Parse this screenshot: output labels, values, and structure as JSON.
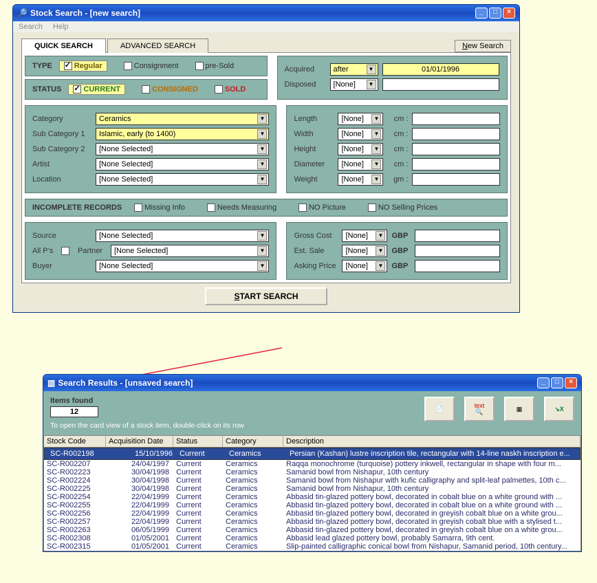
{
  "search_window": {
    "title": "Stock Search - [new search]",
    "menu": {
      "search": "Search",
      "help": "Help"
    },
    "tabs": {
      "quick": "QUICK SEARCH",
      "advanced": "ADVANCED SEARCH"
    },
    "new_search": "New Search",
    "type": {
      "label": "TYPE",
      "regular": "Regular",
      "consignment": "Consignment",
      "presold": "pre-Sold"
    },
    "status": {
      "label": "STATUS",
      "current": "CURRENT",
      "consigned": "CONSIGNED",
      "sold": "SOLD"
    },
    "acquired": {
      "label": "Acquired",
      "op": "after",
      "value": "01/01/1996"
    },
    "disposed": {
      "label": "Disposed",
      "op": "[None]",
      "value": ""
    },
    "category": {
      "label": "Category",
      "value": "Ceramics"
    },
    "sub1": {
      "label": "Sub Category 1",
      "value": "Islamic, early (to 1400)"
    },
    "sub2": {
      "label": "Sub Category 2",
      "value": "[None Selected]"
    },
    "artist": {
      "label": "Artist",
      "value": "[None Selected]"
    },
    "location": {
      "label": "Location",
      "value": "[None Selected]"
    },
    "dims": {
      "length": "Length",
      "width": "Width",
      "height": "Height",
      "diameter": "Diameter",
      "weight": "Weight",
      "none": "[None]",
      "cm": "cm :",
      "gm": "gm :"
    },
    "incomplete": {
      "label": "INCOMPLETE RECORDS",
      "missing": "Missing Info",
      "measure": "Needs Measuring",
      "nopic": "NO Picture",
      "nosell": "NO Selling Prices"
    },
    "source": {
      "label": "Source",
      "value": "[None Selected]"
    },
    "allps": "All P's",
    "partner": {
      "label": "Partner",
      "value": "[None Selected]"
    },
    "buyer": {
      "label": "Buyer",
      "value": "[None Selected]"
    },
    "gross": {
      "label": "Gross Cost",
      "op": "[None]",
      "cur": "GBP"
    },
    "est": {
      "label": "Est. Sale",
      "op": "[None]",
      "cur": "GBP"
    },
    "ask": {
      "label": "Asking Price",
      "op": "[None]",
      "cur": "GBP"
    },
    "start": "START SEARCH"
  },
  "results_window": {
    "title": "Search Results - [unsaved search]",
    "items_found_label": "Items found",
    "items_found": "12",
    "hint": "To open the card view of a stock item, double-click on its row",
    "toolbar": {
      "print": "print",
      "textsearch": "text search",
      "grid": "grid",
      "excel": "excel"
    },
    "cols": {
      "code": "Stock Code",
      "acq": "Acquisition Date",
      "status": "Status",
      "cat": "Category",
      "desc": "Description"
    },
    "rows": [
      {
        "code": "SC-R002198",
        "acq": "15/10/1996",
        "status": "Current",
        "cat": "Ceramics",
        "desc": "Persian (Kashan) lustre inscription tile, rectangular with 14-line naskh inscription e..."
      },
      {
        "code": "SC-R002207",
        "acq": "24/04/1997",
        "status": "Current",
        "cat": "Ceramics",
        "desc": "Raqqa monochrome (turquoise) pottery inkwell, rectangular in shape with four m..."
      },
      {
        "code": "SC-R002223",
        "acq": "30/04/1998",
        "status": "Current",
        "cat": "Ceramics",
        "desc": "Samanid bowl from Nishapur, 10th century"
      },
      {
        "code": "SC-R002224",
        "acq": "30/04/1998",
        "status": "Current",
        "cat": "Ceramics",
        "desc": "Samanid bowl from Nishapur with kufic calligraphy and split-leaf palmettes, 10th c..."
      },
      {
        "code": "SC-R002225",
        "acq": "30/04/1998",
        "status": "Current",
        "cat": "Ceramics",
        "desc": "Samanid bowl from Nishapur, 10th century"
      },
      {
        "code": "SC-R002254",
        "acq": "22/04/1999",
        "status": "Current",
        "cat": "Ceramics",
        "desc": "Abbasid tin-glazed pottery bowl, decorated in cobalt blue on a white ground with ..."
      },
      {
        "code": "SC-R002255",
        "acq": "22/04/1999",
        "status": "Current",
        "cat": "Ceramics",
        "desc": "Abbasid tin-glazed pottery bowl, decorated in cobalt blue on a white ground with ..."
      },
      {
        "code": "SC-R002256",
        "acq": "22/04/1999",
        "status": "Current",
        "cat": "Ceramics",
        "desc": "Abbasid tin-glazed pottery bowl, decorated in greyish cobalt blue on a white grou..."
      },
      {
        "code": "SC-R002257",
        "acq": "22/04/1999",
        "status": "Current",
        "cat": "Ceramics",
        "desc": "Abbasid tin-glazed pottery bowl, decorated in greyish cobalt blue with a stylised t..."
      },
      {
        "code": "SC-R002263",
        "acq": "06/05/1999",
        "status": "Current",
        "cat": "Ceramics",
        "desc": "Abbasid tin-glazed pottery bowl, decorated in greyish cobalt blue on a white grou..."
      },
      {
        "code": "SC-R002308",
        "acq": "01/05/2001",
        "status": "Current",
        "cat": "Ceramics",
        "desc": "Abbasid lead glazed pottery bowl, probably Samarra, 9th cent."
      },
      {
        "code": "SC-R002315",
        "acq": "01/05/2001",
        "status": "Current",
        "cat": "Ceramics",
        "desc": "Slip-painted calligraphic conical bowl from Nishapur, Samanid period, 10th century..."
      }
    ]
  }
}
